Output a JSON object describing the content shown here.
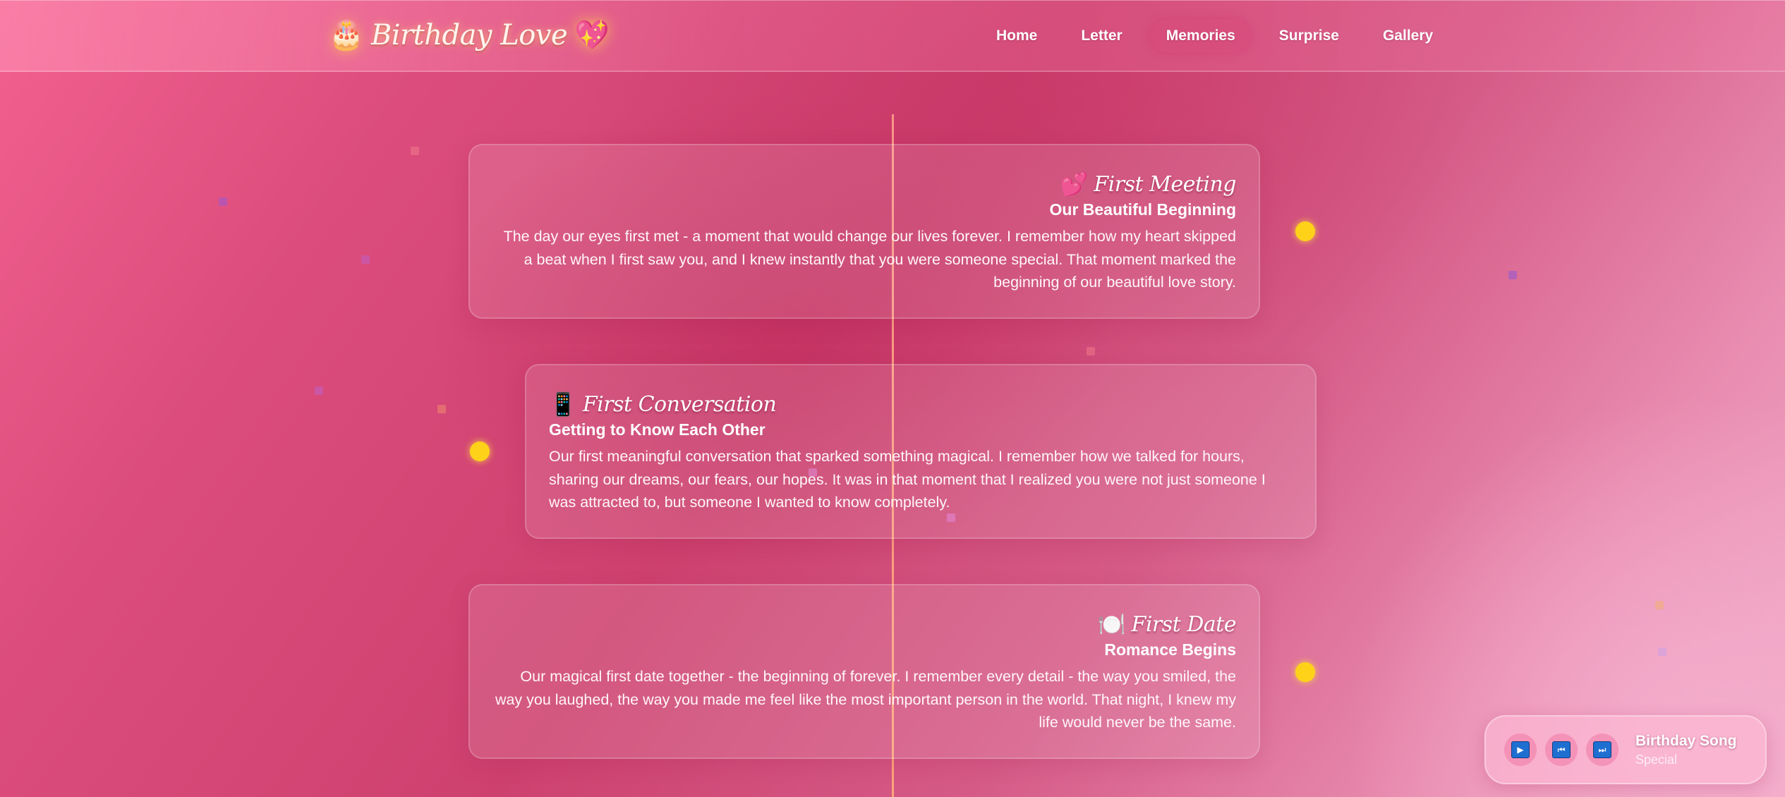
{
  "header": {
    "brand_emoji_left": "🎂",
    "brand_name": "Birthday Love",
    "brand_emoji_right": "💖",
    "nav": [
      {
        "label": "Home",
        "active": false
      },
      {
        "label": "Letter",
        "active": false
      },
      {
        "label": "Memories",
        "active": true
      },
      {
        "label": "Surprise",
        "active": false
      },
      {
        "label": "Gallery",
        "active": false
      }
    ]
  },
  "timeline": [
    {
      "emoji": "💕",
      "title": "First Meeting",
      "subtitle": "Our Beautiful Beginning",
      "text": "The day our eyes first met - a moment that would change our lives forever. I remember how my heart skipped a beat when I first saw you, and I knew instantly that you were someone special. That moment marked the beginning of our beautiful love story."
    },
    {
      "emoji": "📱",
      "title": "First Conversation",
      "subtitle": "Getting to Know Each Other",
      "text": "Our first meaningful conversation that sparked something magical. I remember how we talked for hours, sharing our dreams, our fears, our hopes. It was in that moment that I realized you were not just someone I was attracted to, but someone I wanted to know completely."
    },
    {
      "emoji": "🍽️",
      "title": "First Date",
      "subtitle": "Romance Begins",
      "text": "Our magical first date together - the beginning of forever. I remember every detail - the way you smiled, the way you laughed, the way you made me feel like the most important person in the world. That night, I knew my life would never be the same."
    }
  ],
  "player": {
    "play_icon": "▶",
    "prev_icon": "⏮",
    "next_icon": "⏭",
    "song_title": "Birthday Song",
    "song_subtitle": "Special"
  },
  "colors": {
    "accent_dot": "#ffd21a",
    "timeline_line": "#ffa88c"
  }
}
